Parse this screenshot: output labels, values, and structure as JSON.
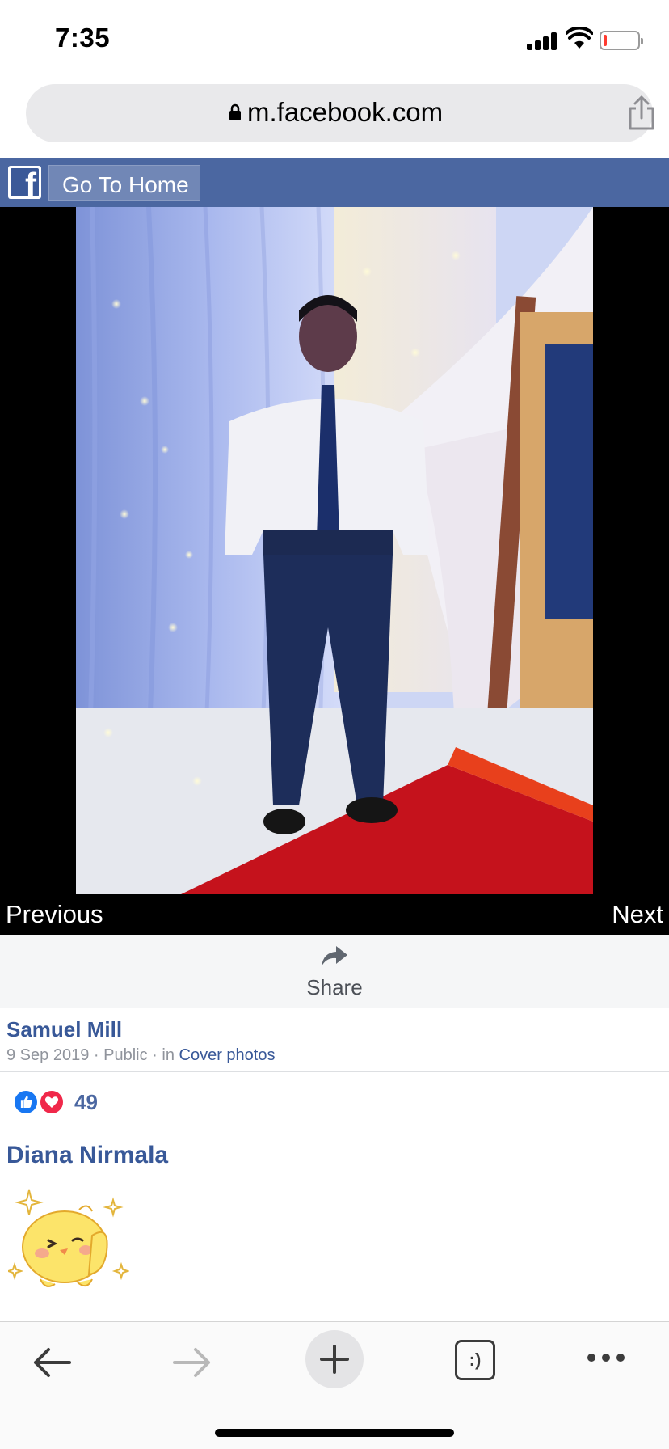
{
  "status_bar": {
    "time": "7:35",
    "battery_level": 0.1
  },
  "browser": {
    "url": "m.facebook.com"
  },
  "header": {
    "home_label": "Go To Home"
  },
  "photo_nav": {
    "previous_label": "Previous",
    "next_label": "Next"
  },
  "actions": {
    "share_label": "Share"
  },
  "post": {
    "author": "Samuel Mill",
    "date": "9 Sep 2019",
    "privacy": "Public",
    "in_label": "in",
    "album": "Cover photos",
    "reaction_count": "49"
  },
  "comment": {
    "author": "Diana Nirmala"
  },
  "toolbar": {
    "tabs_label": ":)"
  },
  "colors": {
    "facebook_blue": "#4b67a1",
    "link_blue": "#385898",
    "like_blue": "#1877f2",
    "love_red": "#f0284a"
  }
}
